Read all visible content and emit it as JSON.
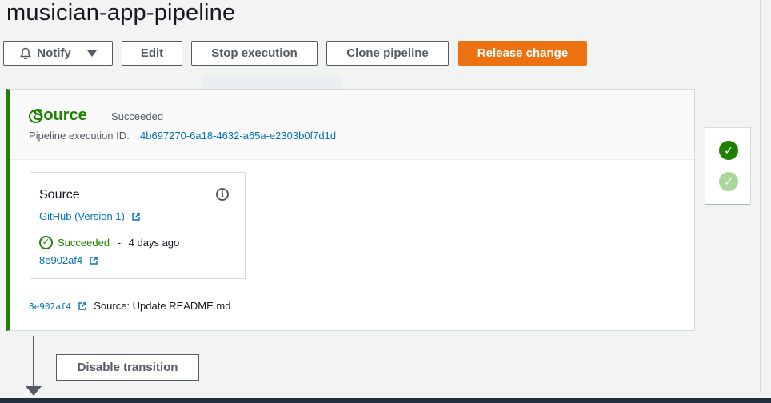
{
  "page": {
    "title": "musician-app-pipeline"
  },
  "toolbar": {
    "notify_label": "Notify",
    "edit_label": "Edit",
    "stop_label": "Stop execution",
    "clone_label": "Clone pipeline",
    "release_label": "Release change",
    "primary_color": "#ec7211"
  },
  "stage": {
    "name": "Source",
    "status": "Succeeded",
    "execution_id_label": "Pipeline execution ID:",
    "execution_id": "4b697270-6a18-4632-a65a-e2303b0f7d1d",
    "status_color": "#1d8102",
    "action": {
      "title": "Source",
      "provider_link": "GitHub (Version 1)",
      "status": "Succeeded",
      "separator": "-",
      "time_ago": "4 days ago",
      "commit_link": "8e902af4"
    },
    "footer": {
      "commit_hash": "8e902af4",
      "commit_message": "Source: Update README.md"
    }
  },
  "side_panel": {
    "items": [
      {
        "state": "succeeded"
      },
      {
        "state": "succeeded-faded"
      }
    ]
  },
  "transition": {
    "disable_label": "Disable transition"
  },
  "icons": {
    "notify": "bell-icon",
    "dropdown": "caret-down-icon",
    "status": "check-circle-icon",
    "info": "info-icon",
    "external": "external-link-icon",
    "arrow": "arrow-down-icon"
  },
  "colors": {
    "link": "#0073bb",
    "success": "#1d8102",
    "background": "#f2f3f3"
  }
}
